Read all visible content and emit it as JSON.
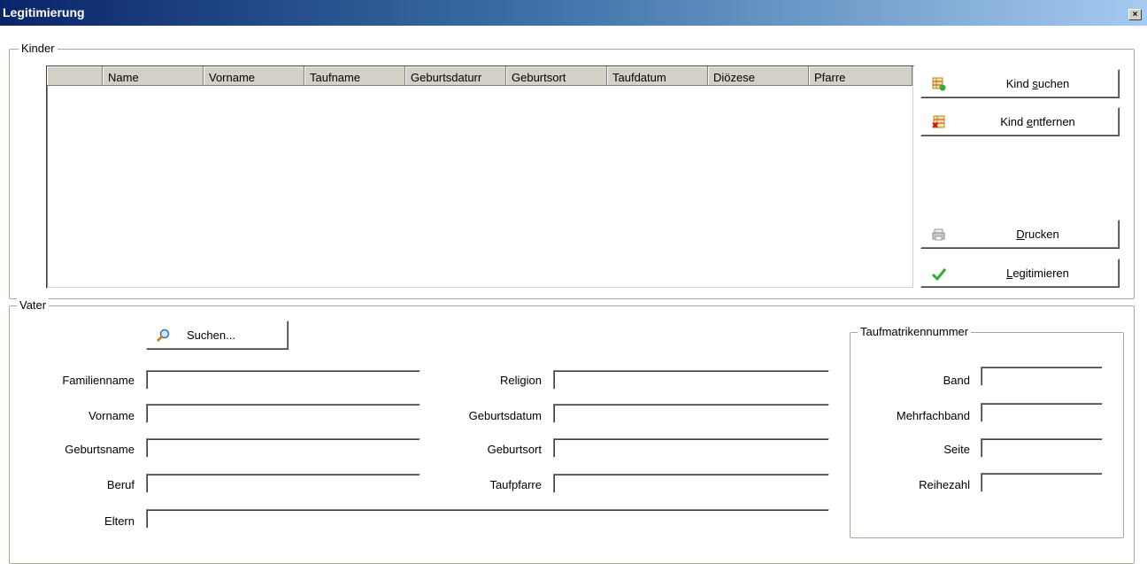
{
  "window": {
    "title": "Legitimierung",
    "close_glyph": "×"
  },
  "kinder": {
    "legend": "Kinder",
    "columns": [
      "",
      "Name",
      "Vorname",
      "Taufname",
      "Geburtsdaturr",
      "Geburtsort",
      "Taufdatum",
      "Diözese",
      "Pfarre"
    ],
    "buttons": {
      "kind_suchen": {
        "pre": "Kind ",
        "accel": "s",
        "post": "uchen",
        "icon": "table-add-icon"
      },
      "kind_entfernen": {
        "pre": "Kind ",
        "accel": "e",
        "post": "ntfernen",
        "icon": "table-remove-icon"
      },
      "drucken": {
        "pre": "",
        "accel": "D",
        "post": "rucken",
        "icon": "printer-icon"
      },
      "legitimieren": {
        "pre": "",
        "accel": "L",
        "post": "egitimieren",
        "icon": "checkmark-icon"
      }
    }
  },
  "vater": {
    "legend": "Vater",
    "suchen_label": "Suchen...",
    "suchen_icon": "magnifier-icon",
    "fields": {
      "familienname": {
        "label": "Familienname",
        "value": ""
      },
      "vorname": {
        "label": "Vorname",
        "value": ""
      },
      "geburtsname": {
        "label": "Geburtsname",
        "value": ""
      },
      "beruf": {
        "label": "Beruf",
        "value": ""
      },
      "eltern": {
        "label": "Eltern",
        "value": ""
      },
      "religion": {
        "label": "Religion",
        "value": ""
      },
      "geburtsdatum": {
        "label": "Geburtsdatum",
        "value": ""
      },
      "geburtsort": {
        "label": "Geburtsort",
        "value": ""
      },
      "taufpfarre": {
        "label": "Taufpfarre",
        "value": ""
      }
    },
    "taufmatrikel": {
      "legend": "Taufmatrikennummer",
      "band": {
        "label": "Band",
        "value": ""
      },
      "mehrfachband": {
        "label": "Mehrfachband",
        "value": ""
      },
      "seite": {
        "label": "Seite",
        "value": ""
      },
      "reihezahl": {
        "label": "Reihezahl",
        "value": ""
      }
    }
  },
  "colors": {
    "accent_green": "#2fae2f",
    "title_dark": "#0a246a",
    "title_light": "#a6caf0"
  }
}
